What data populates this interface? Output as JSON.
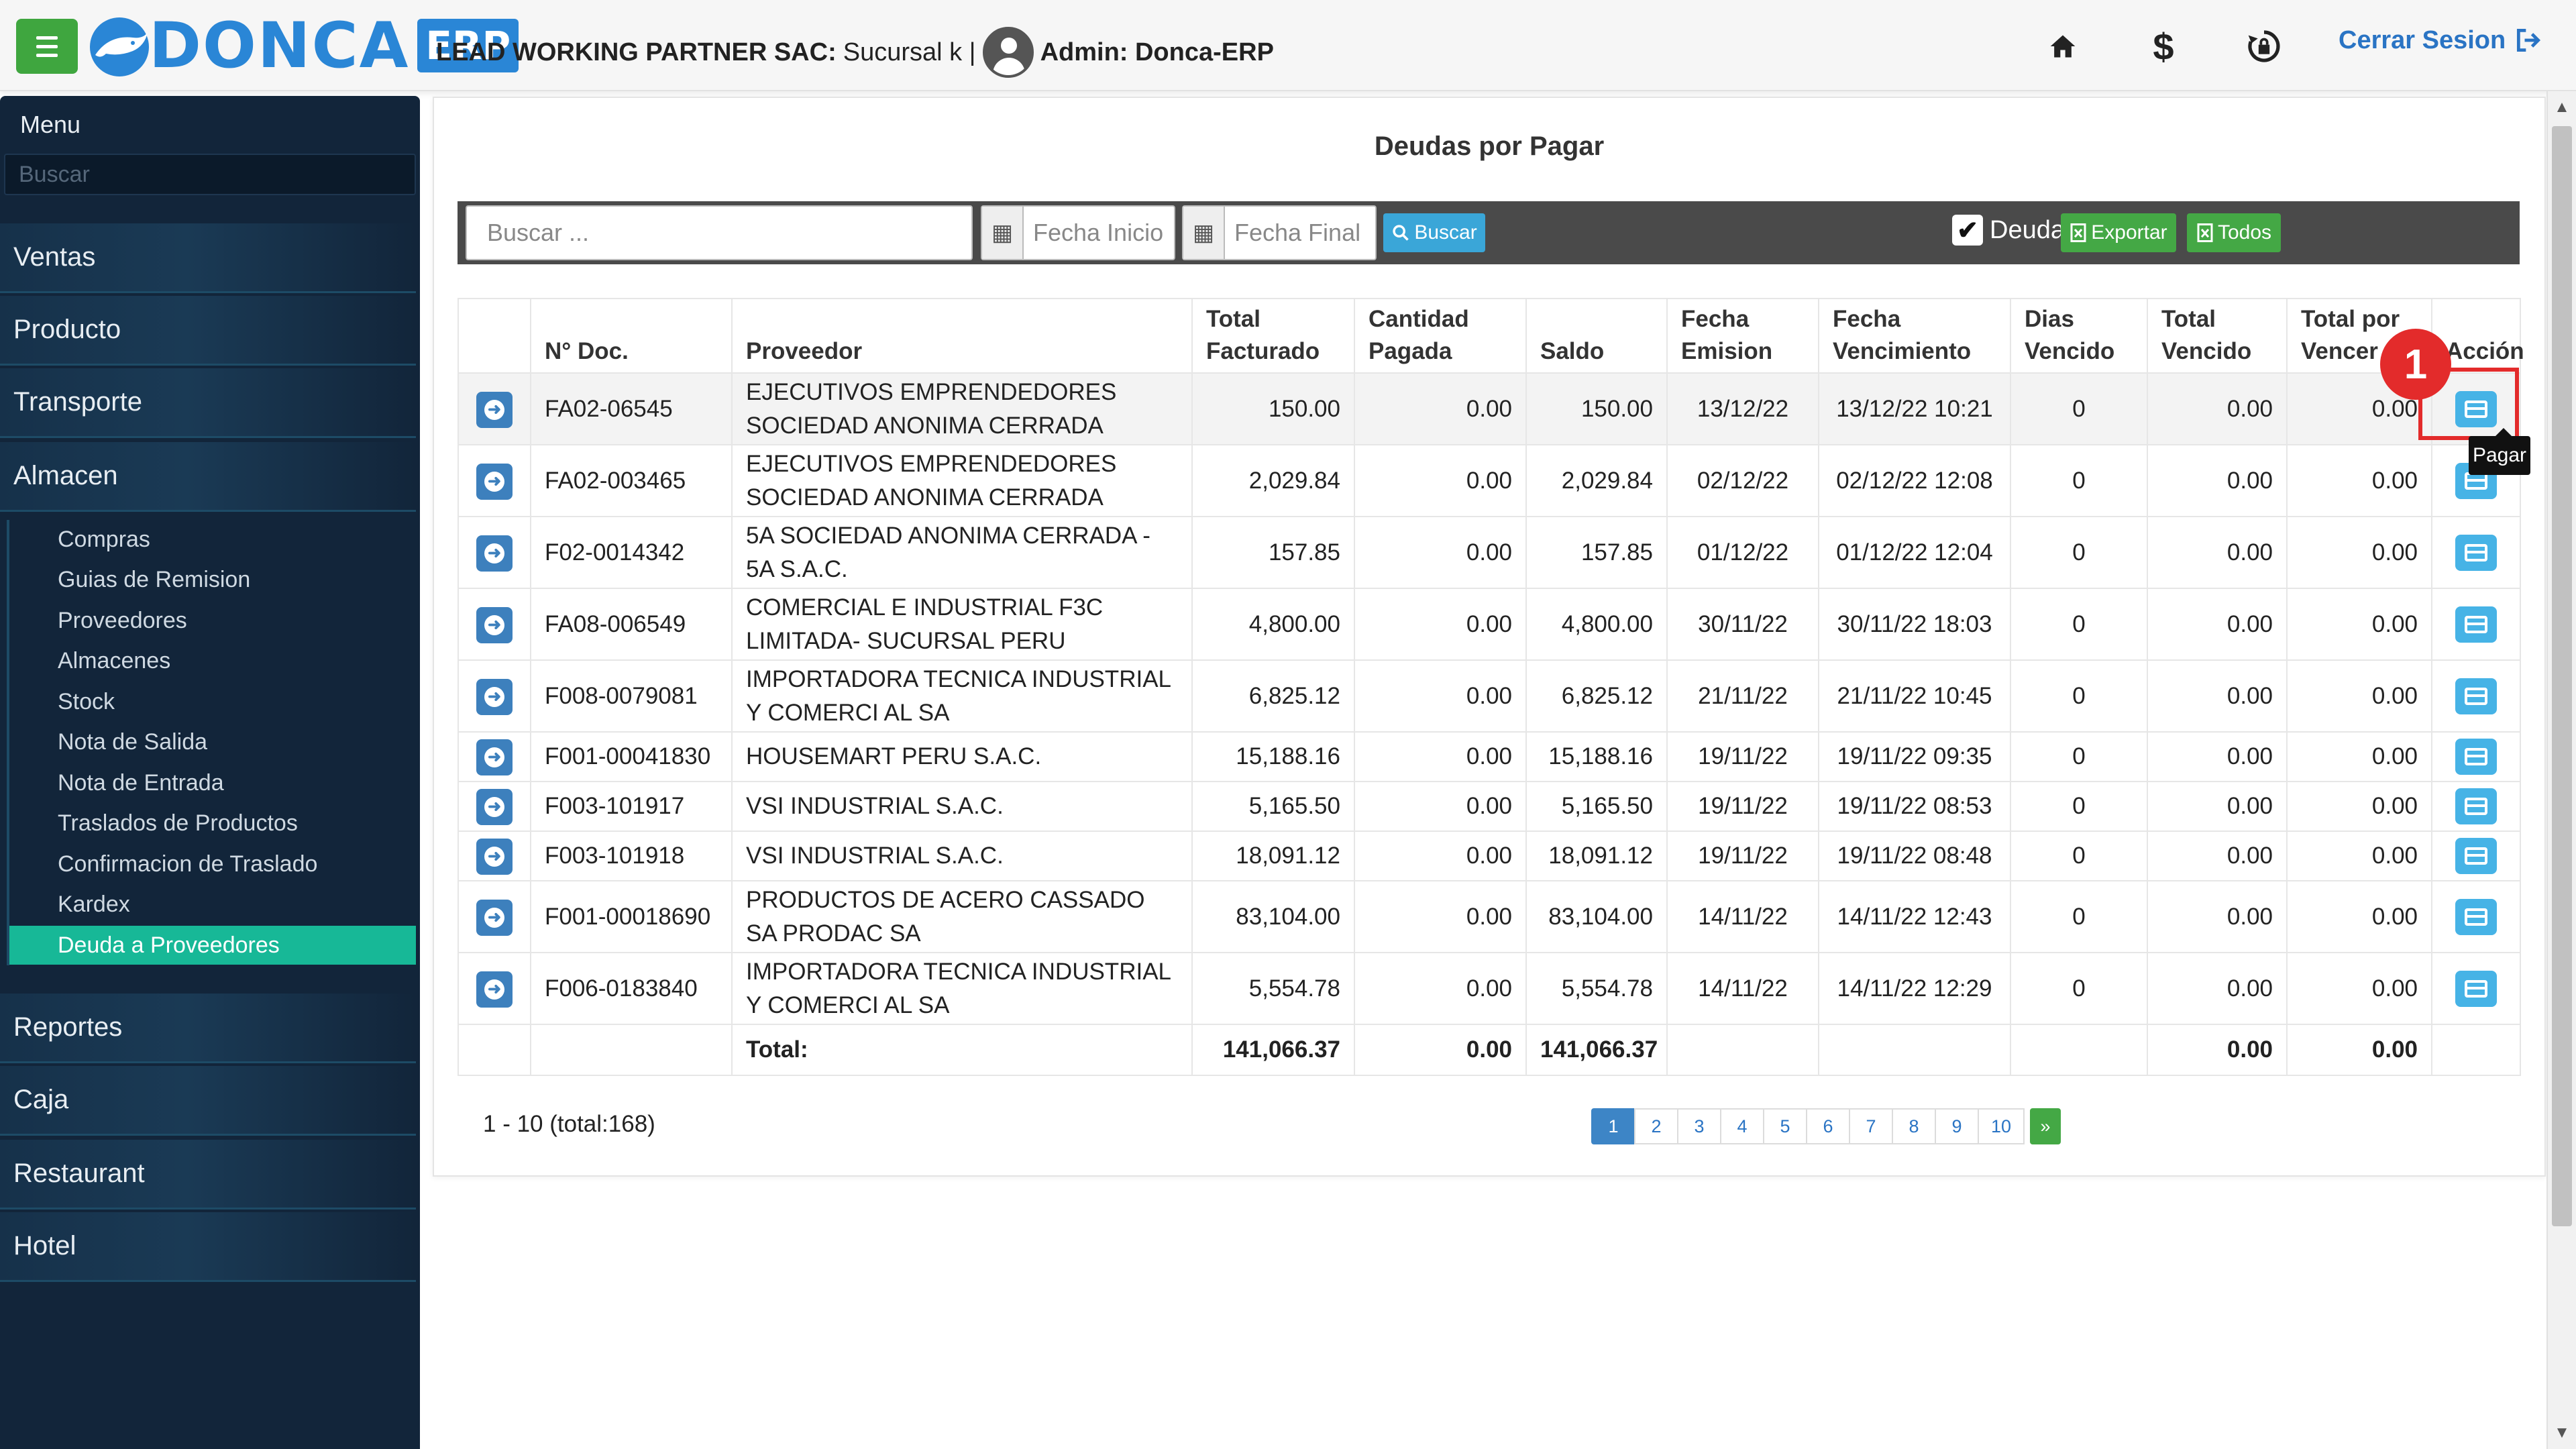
{
  "app": {
    "logo_text": "DONCA",
    "logo_badge": "ERP",
    "company_name": "LEAD WORKING PARTNER SAC:",
    "branch": " Sucursal k |",
    "admin_label": "Admin: Donca-ERP",
    "logout_label": "Cerrar Sesion"
  },
  "sidebar": {
    "title": "Menu",
    "search_placeholder": "Buscar",
    "items": [
      "Ventas",
      "Producto",
      "Transporte",
      "Almacen",
      "Reportes",
      "Caja",
      "Restaurant",
      "Hotel"
    ],
    "submenu": [
      "Compras",
      "Guias de Remision",
      "Proveedores",
      "Almacenes",
      "Stock",
      "Nota de Salida",
      "Nota de Entrada",
      "Traslados de Productos",
      "Confirmacion de Traslado",
      "Kardex",
      "Deuda a Proveedores"
    ],
    "active_submenu": "Deuda a Proveedores"
  },
  "page": {
    "title": "Deudas por Pagar"
  },
  "filters": {
    "search_placeholder": "Buscar ...",
    "date_start_placeholder": "Fecha Inicio",
    "date_end_placeholder": "Fecha Final",
    "search_button": "Buscar",
    "debt_checkbox_label": "Deuda",
    "debt_checked": true,
    "export_button": "Exportar",
    "all_button": "Todos"
  },
  "table": {
    "headers": {
      "doc": "N° Doc.",
      "proveedor": "Proveedor",
      "total_facturado": "Total Facturado",
      "cantidad_pagada": "Cantidad Pagada",
      "saldo": "Saldo",
      "fecha_emision": "Fecha Emision",
      "fecha_vencimiento": "Fecha Vencimiento",
      "dias_vencido": "Dias Vencido",
      "total_vencido": "Total Vencido",
      "total_por_vencer": "Total por Vencer",
      "accion": "Acción"
    },
    "rows": [
      {
        "doc": "FA02-06545",
        "proveedor": "EJECUTIVOS EMPRENDEDORES SOCIEDAD ANONIMA CERRADA",
        "total": "150.00",
        "pagada": "0.00",
        "saldo": "150.00",
        "emision": "13/12/22",
        "vencimiento": "13/12/22 10:21",
        "dias": "0",
        "vencido": "0.00",
        "por_vencer": "0.00"
      },
      {
        "doc": "FA02-003465",
        "proveedor": "EJECUTIVOS EMPRENDEDORES SOCIEDAD ANONIMA CERRADA",
        "total": "2,029.84",
        "pagada": "0.00",
        "saldo": "2,029.84",
        "emision": "02/12/22",
        "vencimiento": "02/12/22 12:08",
        "dias": "0",
        "vencido": "0.00",
        "por_vencer": "0.00"
      },
      {
        "doc": "F02-0014342",
        "proveedor": "5A SOCIEDAD ANONIMA CERRADA - 5A S.A.C.",
        "total": "157.85",
        "pagada": "0.00",
        "saldo": "157.85",
        "emision": "01/12/22",
        "vencimiento": "01/12/22 12:04",
        "dias": "0",
        "vencido": "0.00",
        "por_vencer": "0.00"
      },
      {
        "doc": "FA08-006549",
        "proveedor": "COMERCIAL E INDUSTRIAL F3C LIMITADA- SUCURSAL PERU",
        "total": "4,800.00",
        "pagada": "0.00",
        "saldo": "4,800.00",
        "emision": "30/11/22",
        "vencimiento": "30/11/22 18:03",
        "dias": "0",
        "vencido": "0.00",
        "por_vencer": "0.00"
      },
      {
        "doc": "F008-0079081",
        "proveedor": "IMPORTADORA TECNICA INDUSTRIAL Y COMERCI AL SA",
        "total": "6,825.12",
        "pagada": "0.00",
        "saldo": "6,825.12",
        "emision": "21/11/22",
        "vencimiento": "21/11/22 10:45",
        "dias": "0",
        "vencido": "0.00",
        "por_vencer": "0.00"
      },
      {
        "doc": "F001-00041830",
        "proveedor": "HOUSEMART PERU S.A.C.",
        "total": "15,188.16",
        "pagada": "0.00",
        "saldo": "15,188.16",
        "emision": "19/11/22",
        "vencimiento": "19/11/22 09:35",
        "dias": "0",
        "vencido": "0.00",
        "por_vencer": "0.00"
      },
      {
        "doc": "F003-101917",
        "proveedor": "VSI INDUSTRIAL S.A.C.",
        "total": "5,165.50",
        "pagada": "0.00",
        "saldo": "5,165.50",
        "emision": "19/11/22",
        "vencimiento": "19/11/22 08:53",
        "dias": "0",
        "vencido": "0.00",
        "por_vencer": "0.00"
      },
      {
        "doc": "F003-101918",
        "proveedor": "VSI INDUSTRIAL S.A.C.",
        "total": "18,091.12",
        "pagada": "0.00",
        "saldo": "18,091.12",
        "emision": "19/11/22",
        "vencimiento": "19/11/22 08:48",
        "dias": "0",
        "vencido": "0.00",
        "por_vencer": "0.00"
      },
      {
        "doc": "F001-00018690",
        "proveedor": "PRODUCTOS DE ACERO CASSADO SA PRODAC SA",
        "total": "83,104.00",
        "pagada": "0.00",
        "saldo": "83,104.00",
        "emision": "14/11/22",
        "vencimiento": "14/11/22 12:43",
        "dias": "0",
        "vencido": "0.00",
        "por_vencer": "0.00"
      },
      {
        "doc": "F006-0183840",
        "proveedor": "IMPORTADORA TECNICA INDUSTRIAL Y COMERCI AL SA",
        "total": "5,554.78",
        "pagada": "0.00",
        "saldo": "5,554.78",
        "emision": "14/11/22",
        "vencimiento": "14/11/22 12:29",
        "dias": "0",
        "vencido": "0.00",
        "por_vencer": "0.00"
      }
    ],
    "totals": {
      "label": "Total:",
      "total": "141,066.37",
      "pagada": "0.00",
      "saldo": "141,066.37",
      "vencido": "0.00",
      "por_vencer": "0.00"
    },
    "pay_tooltip": "Pagar",
    "annotation_number": "1"
  },
  "pagination": {
    "summary": "1 - 10 (total:168)",
    "pages": [
      "1",
      "2",
      "3",
      "4",
      "5",
      "6",
      "7",
      "8",
      "9",
      "10"
    ],
    "current": "1",
    "next_label": "»"
  },
  "colors": {
    "sidebar_bg": "#12253a",
    "active_submenu": "#17b897",
    "brand_blue": "#2a86d6",
    "menu_button": "#3fa63f",
    "highlight_red": "#e32b2b"
  },
  "icons": [
    "menu-icon",
    "home-icon",
    "dollar-icon",
    "lock-refresh-icon",
    "logout-icon",
    "calendar-icon",
    "search-icon",
    "excel-icon",
    "arrow-right-icon",
    "credit-card-icon"
  ]
}
